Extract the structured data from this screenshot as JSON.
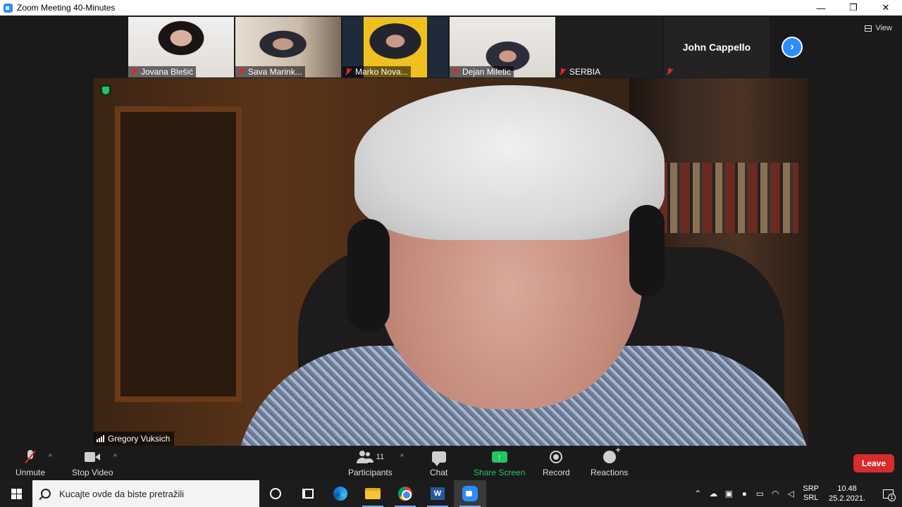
{
  "window": {
    "title": "Zoom Meeting 40-Minutes",
    "minimize": "—",
    "restore": "❐",
    "close": "✕"
  },
  "view_label": "View",
  "thumbnails": [
    {
      "name": "Jovana Blešić",
      "bg": "#e8e4e2",
      "accent": "#1a1412"
    },
    {
      "name": "Sava Marink...",
      "bg": "#d8cfc4",
      "accent": "#2a2a35"
    },
    {
      "name": "Marko Nova...",
      "bg": "#1f2a3a",
      "accent": "#e0b020"
    },
    {
      "name": "Dejan Miletic",
      "bg": "#e9e7e4",
      "accent": "#2c2c3a"
    },
    {
      "name": "SERBIA"
    },
    {
      "name": ""
    }
  ],
  "name_tile": {
    "label": "John Cappello"
  },
  "next_arrow": "›",
  "speaker": {
    "name": "Gregory Vuksich"
  },
  "toolbar": {
    "unmute": "Unmute",
    "stop_video": "Stop Video",
    "participants": "Participants",
    "participants_count": "11",
    "chat": "Chat",
    "share_screen": "Share Screen",
    "share_arrow": "↑",
    "record": "Record",
    "reactions": "Reactions",
    "leave": "Leave",
    "caret": "^"
  },
  "taskbar": {
    "search_placeholder": "Kucajte ovde da biste pretražili",
    "word_letter": "W",
    "lang_top": "SRP",
    "lang_bottom": "SRL",
    "time": "10.48",
    "date": "25.2.2021.",
    "notifications": "1"
  },
  "colors": {
    "zoom_blue": "#2d8cff",
    "leave_red": "#d62c2c",
    "share_green": "#22c55e"
  }
}
